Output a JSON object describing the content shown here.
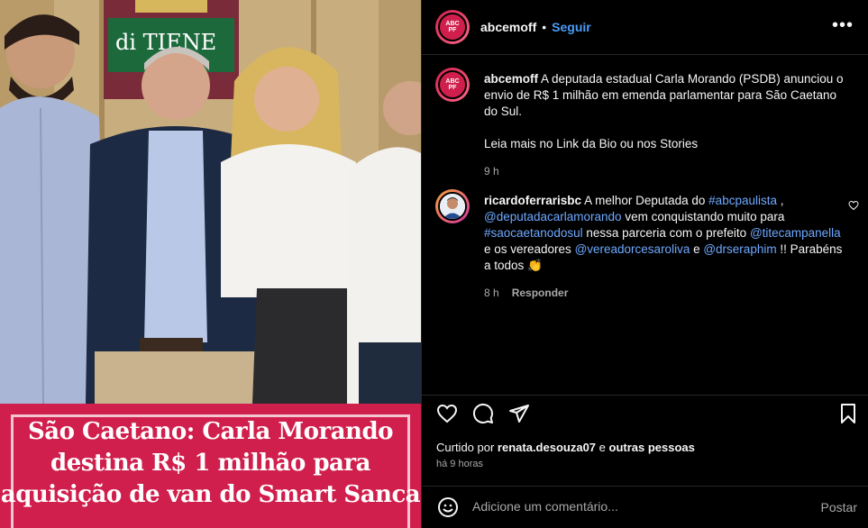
{
  "media": {
    "banner_lines": [
      "São Caetano: Carla Morando",
      "destina R$ 1 milhão para",
      "aquisição de van do Smart Sanca"
    ],
    "background_sign_text": "di TIENE"
  },
  "header": {
    "avatar_text": "ABC\nPF",
    "username": "abcemoff",
    "separator": "•",
    "follow_label": "Seguir",
    "more_label": "•••"
  },
  "caption": {
    "username": "abcemoff",
    "text": "A deputada estadual Carla Morando (PSDB) anunciou o envio de R$ 1 milhão em emenda parlamentar para São Caetano do Sul.",
    "text2": "Leia mais no Link da Bio ou nos Stories",
    "time": "9 h"
  },
  "comment": {
    "username": "ricardoferrarisbc",
    "t1": "A melhor Deputada do ",
    "tag1": "#abcpaulista",
    "t2": " , ",
    "mention1": "@deputadacarlamorando",
    "t3": " vem conquistando muito para ",
    "tag2": "#saocaetanodosul",
    "t4": " nessa parceria com o prefeito ",
    "mention2": "@titecampanella",
    "t5": " e os vereadores ",
    "mention3": "@vereadorcesaroliva",
    "t6": " e ",
    "mention4": "@drseraphim",
    "t7": " !! Parabéns a todos 👏",
    "time": "8 h",
    "reply_label": "Responder"
  },
  "likes": {
    "prefix": "Curtido por ",
    "user": "renata.desouza07",
    "middle": " e ",
    "others": "outras pessoas",
    "ago": "há 9 horas"
  },
  "add_comment": {
    "placeholder": "Adicione um comentário...",
    "post_label": "Postar"
  },
  "colors": {
    "banner": "#d01f4c",
    "link": "#6ea8fe",
    "follow": "#4b9cf7"
  }
}
